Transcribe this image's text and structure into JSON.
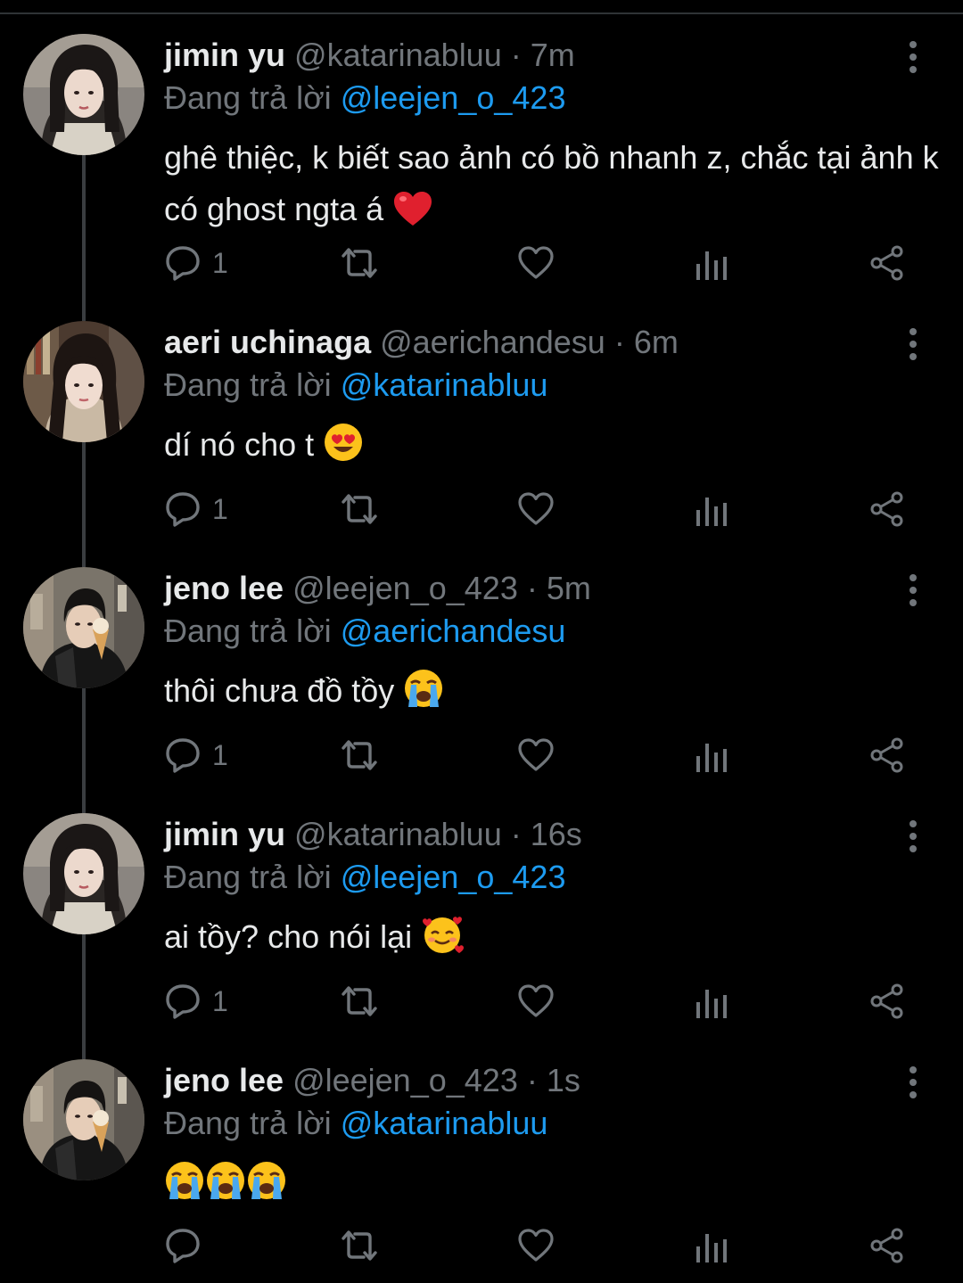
{
  "thread": {
    "reply_prefix": "Đang trả lời",
    "tweets": [
      {
        "display_name": "jimin yu",
        "handle": "@katarinabluu",
        "separator": "·",
        "time": "7m",
        "replying_to": "@leejen_o_423",
        "text": "ghê thiệc, k biết sao ảnh có bồ nhanh z, chắc tại ảnh k có ghost ngta á",
        "emoji": "red-heart",
        "reply_count": "1"
      },
      {
        "display_name": "aeri uchinaga",
        "handle": "@aerichandesu",
        "separator": "·",
        "time": "6m",
        "replying_to": "@katarinabluu",
        "text": "dí nó cho t",
        "emoji": "heart-eyes",
        "reply_count": "1"
      },
      {
        "display_name": "jeno lee",
        "handle": "@leejen_o_423",
        "separator": "·",
        "time": "5m",
        "replying_to": "@aerichandesu",
        "text": "thôi chưa đồ tồy",
        "emoji": "loudly-crying",
        "reply_count": "1"
      },
      {
        "display_name": "jimin yu",
        "handle": "@katarinabluu",
        "separator": "·",
        "time": "16s",
        "replying_to": "@leejen_o_423",
        "text": "ai tồy? cho nói lại",
        "emoji": "smiling-with-hearts",
        "reply_count": "1"
      },
      {
        "display_name": "jeno lee",
        "handle": "@leejen_o_423",
        "separator": "·",
        "time": "1s",
        "replying_to": "@katarinabluu",
        "text": "",
        "emoji": "loudly-crying x3",
        "reply_count": ""
      }
    ]
  },
  "icons": {
    "reply": "speech-bubble-icon",
    "retweet": "retweet-icon",
    "like": "heart-outline-icon",
    "views": "bar-chart-icon",
    "share": "share-icon",
    "more": "vertical-dots-icon"
  },
  "colors": {
    "background": "#000000",
    "primary_text": "#e7e9ea",
    "secondary_text": "#71767b",
    "link": "#1d9bf0",
    "icon": "#71767b",
    "thread_line": "#3a3d40"
  }
}
